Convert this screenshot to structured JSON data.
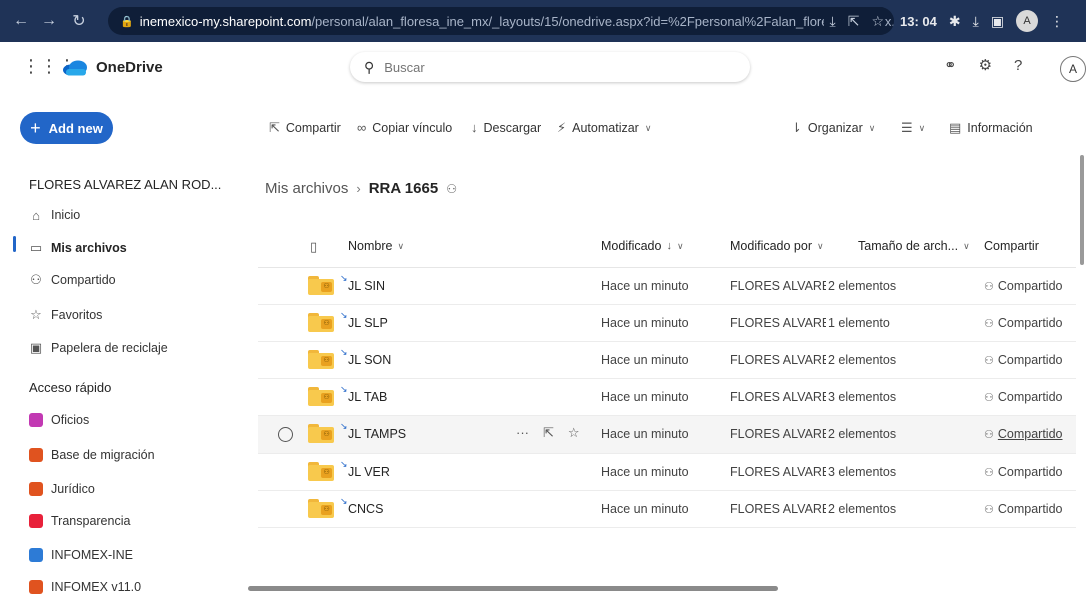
{
  "browser": {
    "url_host": "inemexico-my.sharepoint.com",
    "url_path": "/personal/alan_floresa_ine_mx/_layouts/15/onedrive.aspx?id=%2Fpersonal%2Falan_floresa_ine_mx...",
    "clock": "13: 04",
    "profile_initial": "A"
  },
  "suite": {
    "app_name": "OneDrive",
    "search_placeholder": "Buscar",
    "avatar_initial": "A"
  },
  "sidebar": {
    "add_new_label": "Add new",
    "user_name": "FLORES ALVAREZ ALAN ROD...",
    "nav": [
      {
        "label": "Inicio",
        "icon": "home-icon"
      },
      {
        "label": "Mis archivos",
        "icon": "folder-icon",
        "active": true
      },
      {
        "label": "Compartido",
        "icon": "people-icon"
      },
      {
        "label": "Favoritos",
        "icon": "star-icon"
      },
      {
        "label": "Papelera de reciclaje",
        "icon": "recycle-bin-icon"
      }
    ],
    "quick_access_heading": "Acceso rápido",
    "quick_access": [
      {
        "label": "Oficios",
        "color": "#c239b3"
      },
      {
        "label": "Base de migración",
        "color": "#e0531f"
      },
      {
        "label": "Jurídico",
        "color": "#e0531f"
      },
      {
        "label": "Transparencia",
        "color": "#e8213a"
      },
      {
        "label": "INFOMEX-INE",
        "color": "#2d7bd6"
      },
      {
        "label": "INFOMEX v11.0",
        "color": "#e0531f"
      }
    ]
  },
  "commandbar": {
    "share": "Compartir",
    "copy_link": "Copiar vínculo",
    "download": "Descargar",
    "automate": "Automatizar",
    "sort": "Organizar",
    "info": "Información"
  },
  "breadcrumb": {
    "root": "Mis archivos",
    "current": "RRA 1665"
  },
  "table": {
    "headers": {
      "name": "Nombre",
      "modified": "Modificado",
      "modified_by": "Modificado por",
      "size": "Tamaño de arch...",
      "sharing": "Compartir"
    },
    "rows": [
      {
        "name": "JL SIN",
        "modified": "Hace un minuto",
        "modified_by": "FLORES ALVAREZ ALAI",
        "size": "2 elementos",
        "sharing": "Compartido"
      },
      {
        "name": "JL SLP",
        "modified": "Hace un minuto",
        "modified_by": "FLORES ALVAREZ ALAI",
        "size": "1 elemento",
        "sharing": "Compartido"
      },
      {
        "name": "JL SON",
        "modified": "Hace un minuto",
        "modified_by": "FLORES ALVAREZ ALAI",
        "size": "2 elementos",
        "sharing": "Compartido"
      },
      {
        "name": "JL TAB",
        "modified": "Hace un minuto",
        "modified_by": "FLORES ALVAREZ ALAI",
        "size": "3 elementos",
        "sharing": "Compartido"
      },
      {
        "name": "JL TAMPS",
        "modified": "Hace un minuto",
        "modified_by": "FLORES ALVAREZ ALAI",
        "size": "2 elementos",
        "sharing": "Compartido",
        "hover": true
      },
      {
        "name": "JL VER",
        "modified": "Hace un minuto",
        "modified_by": "FLORES ALVAREZ ALAI",
        "size": "3 elementos",
        "sharing": "Compartido"
      },
      {
        "name": "CNCS",
        "modified": "Hace un minuto",
        "modified_by": "FLORES ALVAREZ ALAI",
        "size": "2 elementos",
        "sharing": "Compartido"
      }
    ]
  }
}
